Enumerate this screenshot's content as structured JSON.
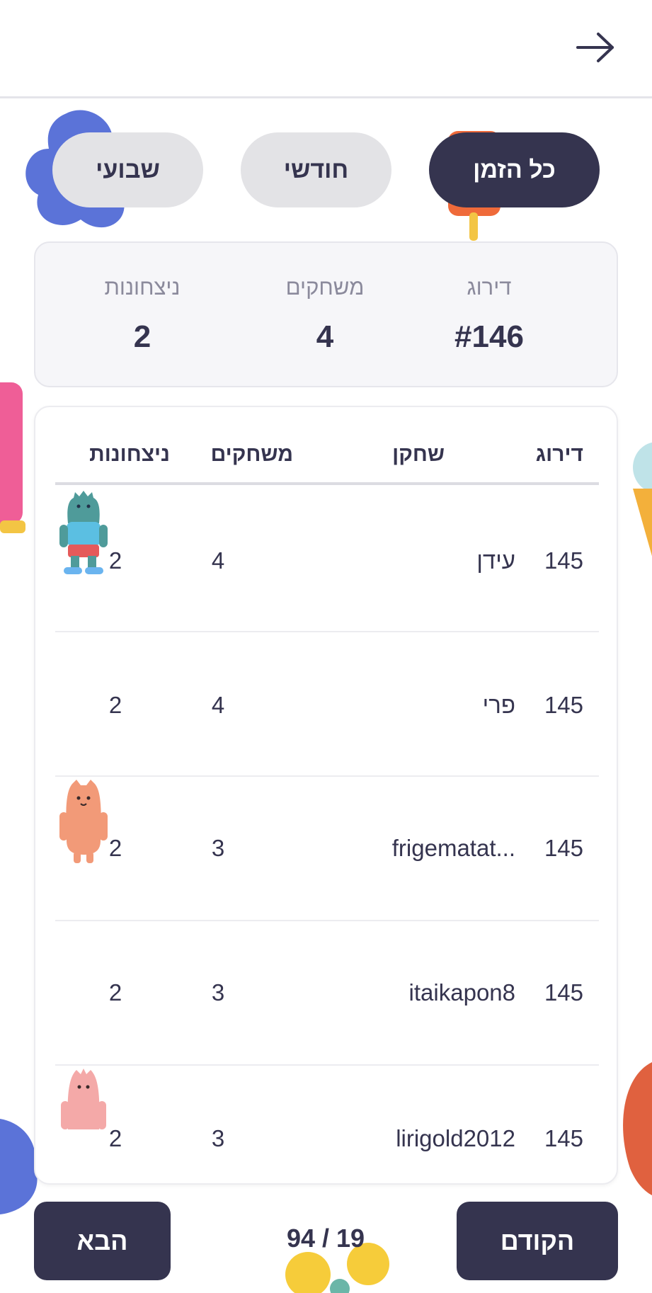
{
  "header": {
    "back_icon": "arrow-right-icon"
  },
  "tabs": [
    {
      "label": "כל הזמן",
      "active": true
    },
    {
      "label": "חודשי",
      "active": false
    },
    {
      "label": "שבועי",
      "active": false
    }
  ],
  "summary": {
    "rank_label": "דירוג",
    "rank_value": "#146",
    "games_label": "משחקים",
    "games_value": "4",
    "wins_label": "ניצחונות",
    "wins_value": "2"
  },
  "table": {
    "headers": {
      "rank": "דירוג",
      "player": "שחקן",
      "games": "משחקים",
      "wins": "ניצחונות"
    },
    "rows": [
      {
        "rank": "145",
        "name": "עידן",
        "avatar": "teal-monster-avatar",
        "games": "4",
        "wins": "2"
      },
      {
        "rank": "145",
        "name": "פרי",
        "avatar": "",
        "games": "4",
        "wins": "2"
      },
      {
        "rank": "145",
        "name": "frigematat...",
        "avatar": "orange-monster-avatar",
        "games": "3",
        "wins": "2"
      },
      {
        "rank": "145",
        "name": "itaikapon8",
        "avatar": "",
        "games": "3",
        "wins": "2"
      },
      {
        "rank": "145",
        "name": "lirigold2012",
        "avatar": "pink-monster-avatar",
        "games": "3",
        "wins": "2"
      }
    ]
  },
  "pagination": {
    "prev_label": "הקודם",
    "next_label": "הבא",
    "page_text": "94 / 19"
  },
  "colors": {
    "primary": "#35344f",
    "tab_inactive": "#e3e3e6",
    "summary_bg": "#f6f6f9"
  }
}
